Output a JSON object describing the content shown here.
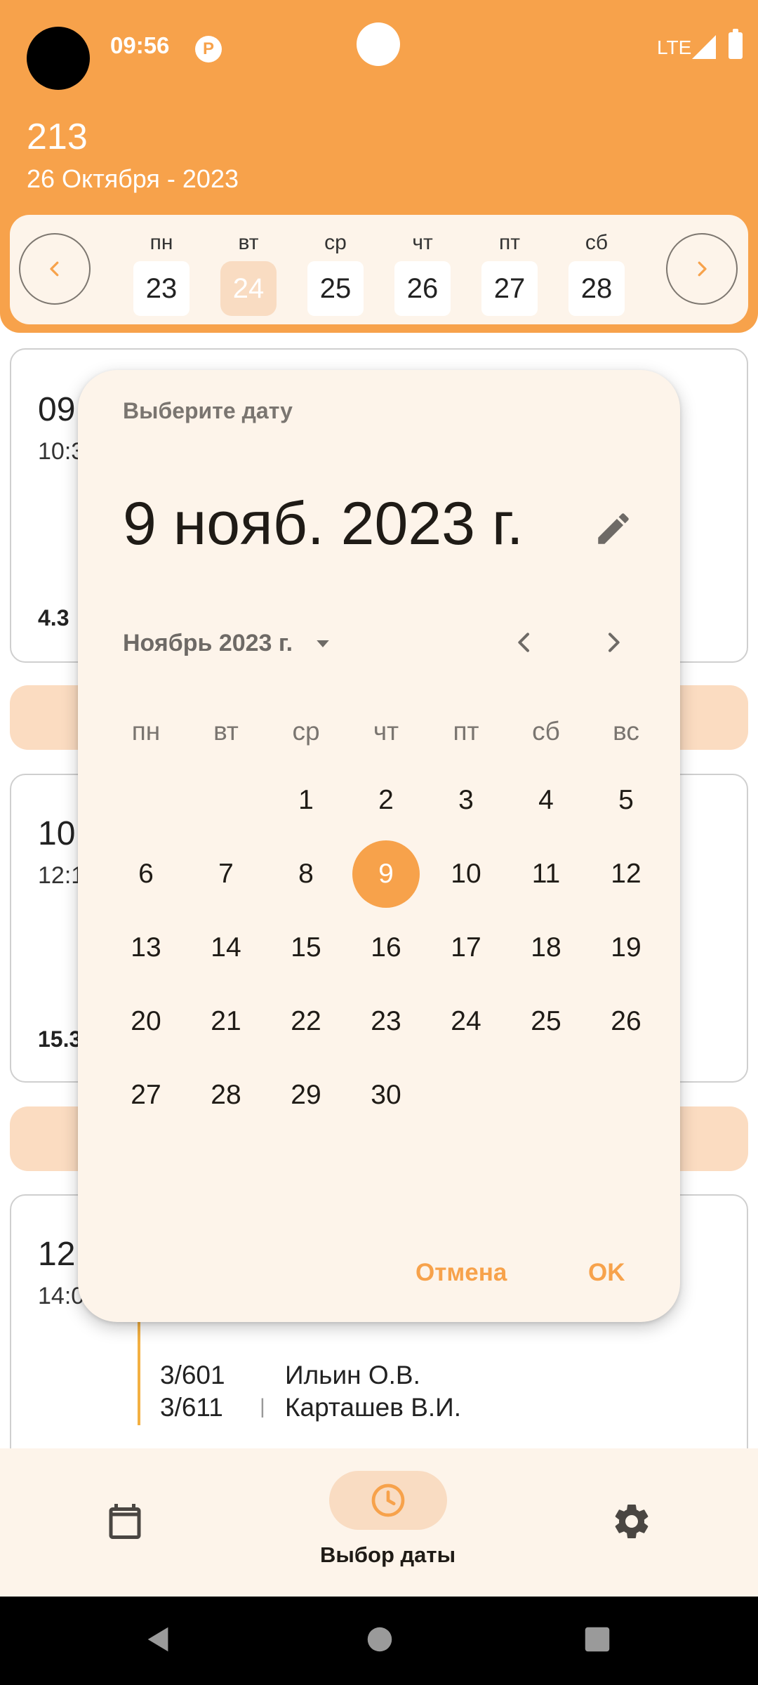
{
  "status_bar": {
    "time": "09:56",
    "app_icon_label": "P",
    "network": "LTE"
  },
  "header": {
    "group": "213",
    "date_text": "26 Октября - 2023"
  },
  "week": {
    "days": [
      {
        "label": "пн",
        "num": "23"
      },
      {
        "label": "вт",
        "num": "24",
        "selected": true
      },
      {
        "label": "ср",
        "num": "25"
      },
      {
        "label": "чт",
        "num": "26"
      },
      {
        "label": "пт",
        "num": "27"
      },
      {
        "label": "сб",
        "num": "28"
      }
    ]
  },
  "cards": [
    {
      "start": "09",
      "end": "10:3",
      "room": "4.3"
    },
    {
      "start": "10",
      "end": "12:1",
      "room": "15.3"
    },
    {
      "start": "12",
      "end": "14:0"
    }
  ],
  "lessons": [
    {
      "room": "3/601",
      "teacher": "Ильин О.В."
    },
    {
      "room": "3/611",
      "separator": "|",
      "teacher": "Карташев В.И."
    }
  ],
  "date_picker": {
    "heading": "Выберите дату",
    "selected_date": "9 нояб. 2023 г.",
    "month_label": "Ноябрь 2023 г.",
    "weekdays": [
      "пн",
      "вт",
      "ср",
      "чт",
      "пт",
      "сб",
      "вс"
    ],
    "weeks": [
      [
        "",
        "",
        "1",
        "2",
        "3",
        "4",
        "5"
      ],
      [
        "6",
        "7",
        "8",
        "9",
        "10",
        "11",
        "12"
      ],
      [
        "13",
        "14",
        "15",
        "16",
        "17",
        "18",
        "19"
      ],
      [
        "20",
        "21",
        "22",
        "23",
        "24",
        "25",
        "26"
      ],
      [
        "27",
        "28",
        "29",
        "30",
        "",
        "",
        ""
      ]
    ],
    "selected_day": "9",
    "cancel_label": "Отмена",
    "ok_label": "OK"
  },
  "bottom_nav": {
    "active_label": "Выбор даты"
  },
  "colors": {
    "accent": "#f7a24b",
    "surface": "#fdf4ea",
    "pill": "#f9dcc2"
  }
}
